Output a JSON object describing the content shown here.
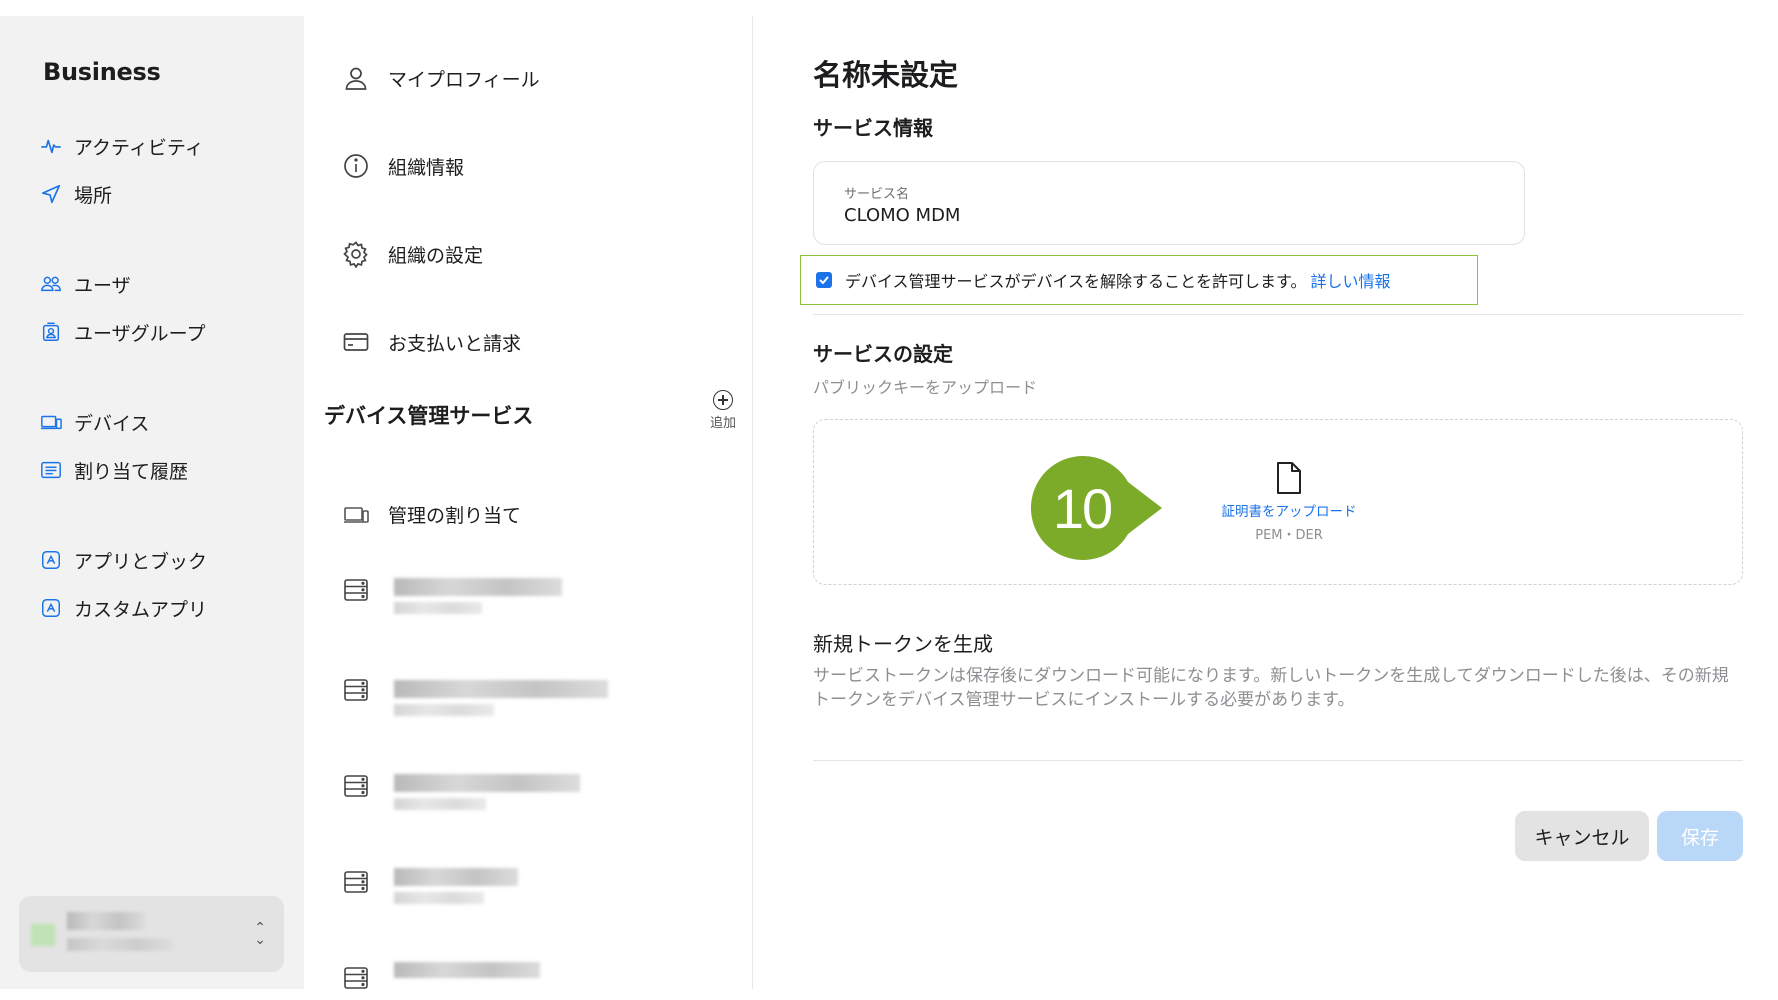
{
  "brand": {
    "name": "Business"
  },
  "sidebar": {
    "items": [
      {
        "label": "アクティビティ",
        "icon": "activity-icon"
      },
      {
        "label": "場所",
        "icon": "location-arrow-icon"
      },
      {
        "label": "ユーザ",
        "icon": "users-icon"
      },
      {
        "label": "ユーザグループ",
        "icon": "user-group-icon"
      },
      {
        "label": "デバイス",
        "icon": "devices-icon"
      },
      {
        "label": "割り当て履歴",
        "icon": "history-list-icon"
      },
      {
        "label": "アプリとブック",
        "icon": "app-store-icon"
      },
      {
        "label": "カスタムアプリ",
        "icon": "custom-app-icon"
      }
    ]
  },
  "middle": {
    "items": [
      {
        "label": "マイプロフィール",
        "icon": "person-icon"
      },
      {
        "label": "組織情報",
        "icon": "info-icon"
      },
      {
        "label": "組織の設定",
        "icon": "gear-icon"
      },
      {
        "label": "お支払いと請求",
        "icon": "credit-card-icon"
      }
    ],
    "section_title": "デバイス管理サービス",
    "add_label": "追加",
    "assign_label": "管理の割り当て"
  },
  "main": {
    "title": "名称未設定",
    "service_info_heading": "サービス情報",
    "service_name_label": "サービス名",
    "service_name_value": "CLOMO MDM",
    "checkbox_text": "デバイス管理サービスがデバイスを解除することを許可します。",
    "checkbox_checked": true,
    "learn_more": "詳しい情報",
    "settings_heading": "サービスの設定",
    "upload_public_key": "パブリックキーをアップロード",
    "upload_cert_link": "証明書をアップロード",
    "upload_formats": "PEM・DER",
    "step_badge": "10",
    "token_heading": "新規トークンを生成",
    "token_desc": "サービストークンは保存後にダウンロード可能になります。新しいトークンを生成してダウンロードした後は、その新規トークンをデバイス管理サービスにインストールする必要があります。",
    "cancel": "キャンセル",
    "save": "保存"
  },
  "colors": {
    "accent": "#1a73e8",
    "badge": "#7cab2a",
    "highlight_border": "#8fc23c",
    "save_disabled": "#b9d7f7"
  }
}
